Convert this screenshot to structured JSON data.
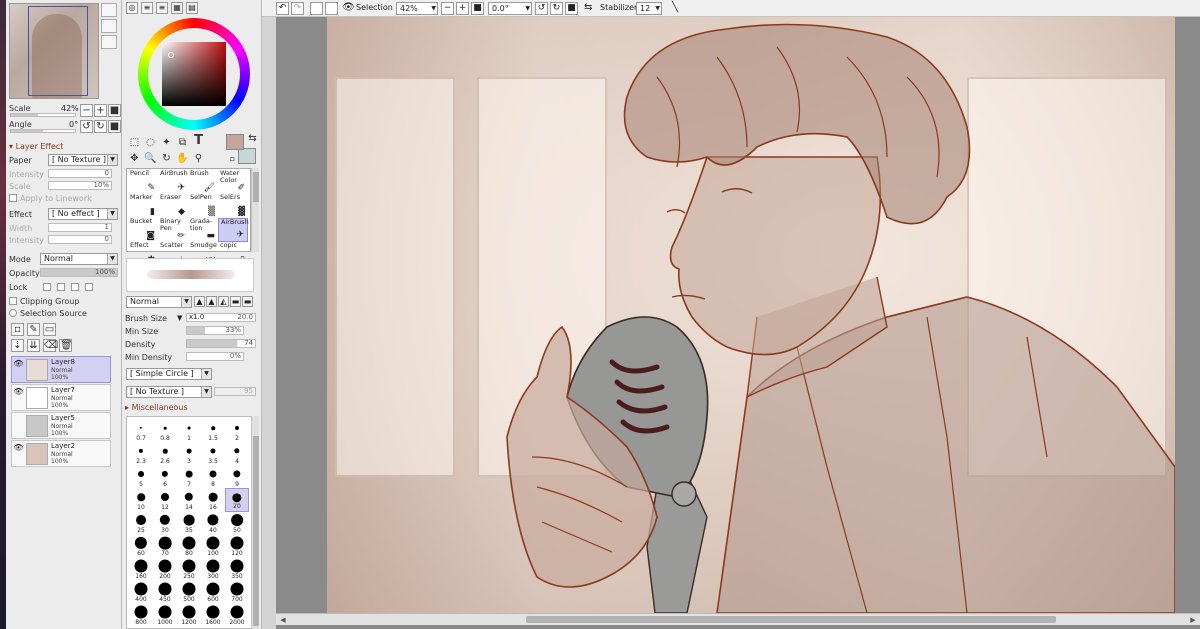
{
  "navigator": {
    "scale_label": "Scale",
    "scale_value": "42%",
    "angle_label": "Angle",
    "angle_value": "0°"
  },
  "layer_effect": {
    "title": "Layer Effect",
    "paper_label": "Paper",
    "paper_value": "[ No Texture ]",
    "intensity_label": "Intensity",
    "intensity_value": "0",
    "scale_label": "Scale",
    "scale_value": "10%",
    "apply_linework": "Apply to Linework",
    "effect_label": "Effect",
    "effect_value": "[ No effect ]",
    "width_label": "Width",
    "width_value": "1",
    "intensity2_label": "Intensity",
    "intensity2_value": "0"
  },
  "layer_props": {
    "mode_label": "Mode",
    "mode_value": "Normal",
    "opacity_label": "Opacity",
    "opacity_value": "100%",
    "opacity_fraction": 1.0,
    "lock_label": "Lock",
    "clipping_group": "Clipping Group",
    "selection_source": "Selection Source"
  },
  "layers": [
    {
      "name": "Layer8",
      "mode": "Normal",
      "opacity": "100%",
      "visible": true,
      "selected": true
    },
    {
      "name": "Layer7",
      "mode": "Normal",
      "opacity": "100%",
      "visible": true,
      "selected": false
    },
    {
      "name": "Layer5",
      "mode": "Normal",
      "opacity": "100%",
      "visible": false,
      "selected": false
    },
    {
      "name": "Layer2",
      "mode": "Normal",
      "opacity": "100%",
      "visible": true,
      "selected": false
    }
  ],
  "colors": {
    "main": "#c4a59a",
    "sub": "#c9d7d8"
  },
  "brushes": [
    {
      "label": "Pencil",
      "icon": "pencil-icon",
      "selected": false
    },
    {
      "label": "AirBrush",
      "icon": "airbrush-icon",
      "selected": false
    },
    {
      "label": "Brush",
      "icon": "brush-icon",
      "selected": false
    },
    {
      "label": "Water Color",
      "icon": "watercolor-icon",
      "selected": false
    },
    {
      "label": "Marker",
      "icon": "marker-icon",
      "selected": false
    },
    {
      "label": "Eraser",
      "icon": "eraser-icon",
      "selected": false
    },
    {
      "label": "SelPen",
      "icon": "selpen-icon",
      "selected": false
    },
    {
      "label": "SelErs",
      "icon": "selers-icon",
      "selected": false
    },
    {
      "label": "Bucket",
      "icon": "bucket-icon",
      "selected": false
    },
    {
      "label": "Binary Pen",
      "icon": "binary-pen-icon",
      "selected": false
    },
    {
      "label": "Grada-tion",
      "icon": "gradation-icon",
      "selected": false
    },
    {
      "label": "AirBrush",
      "icon": "airbrush-icon",
      "selected": true
    },
    {
      "label": "Effect",
      "icon": "effect-icon",
      "selected": false
    },
    {
      "label": "Scatter",
      "icon": "scatter-icon",
      "selected": false
    },
    {
      "label": "Smudge",
      "icon": "smudge-icon",
      "selected": false
    },
    {
      "label": "copic",
      "icon": "copic-icon",
      "selected": false
    }
  ],
  "brush_settings": {
    "blend_mode": "Normal",
    "brush_size_label": "Brush Size",
    "brush_size_mult": "x1.0",
    "brush_size_value": "20.0",
    "min_size_label": "Min Size",
    "min_size_value": "33%",
    "min_size_fraction": 0.33,
    "density_label": "Density",
    "density_value": "74",
    "density_fraction": 0.74,
    "min_density_label": "Min Density",
    "min_density_value": "0%",
    "min_density_fraction": 0.0,
    "shape_value": "[ Simple Circle ]",
    "texture_value": "[ No Texture ]",
    "texture_strength": "95",
    "misc_label": "Miscellaneous"
  },
  "brush_sizes": [
    "0.7",
    "0.8",
    "1",
    "1.5",
    "2",
    "2.3",
    "2.6",
    "3",
    "3.5",
    "4",
    "5",
    "6",
    "7",
    "8",
    "9",
    "10",
    "12",
    "14",
    "16",
    "20",
    "25",
    "30",
    "35",
    "40",
    "50",
    "60",
    "70",
    "80",
    "100",
    "120",
    "160",
    "200",
    "250",
    "300",
    "350",
    "400",
    "450",
    "500",
    "600",
    "700",
    "800",
    "1000",
    "1200",
    "1600",
    "2000"
  ],
  "selected_brush_size": "20",
  "toolbar": {
    "selection_label": "Selection",
    "zoom_value": "42%",
    "rotation_value": "0.0°",
    "stabilizer_label": "Stabilizer",
    "stabilizer_value": "12"
  }
}
